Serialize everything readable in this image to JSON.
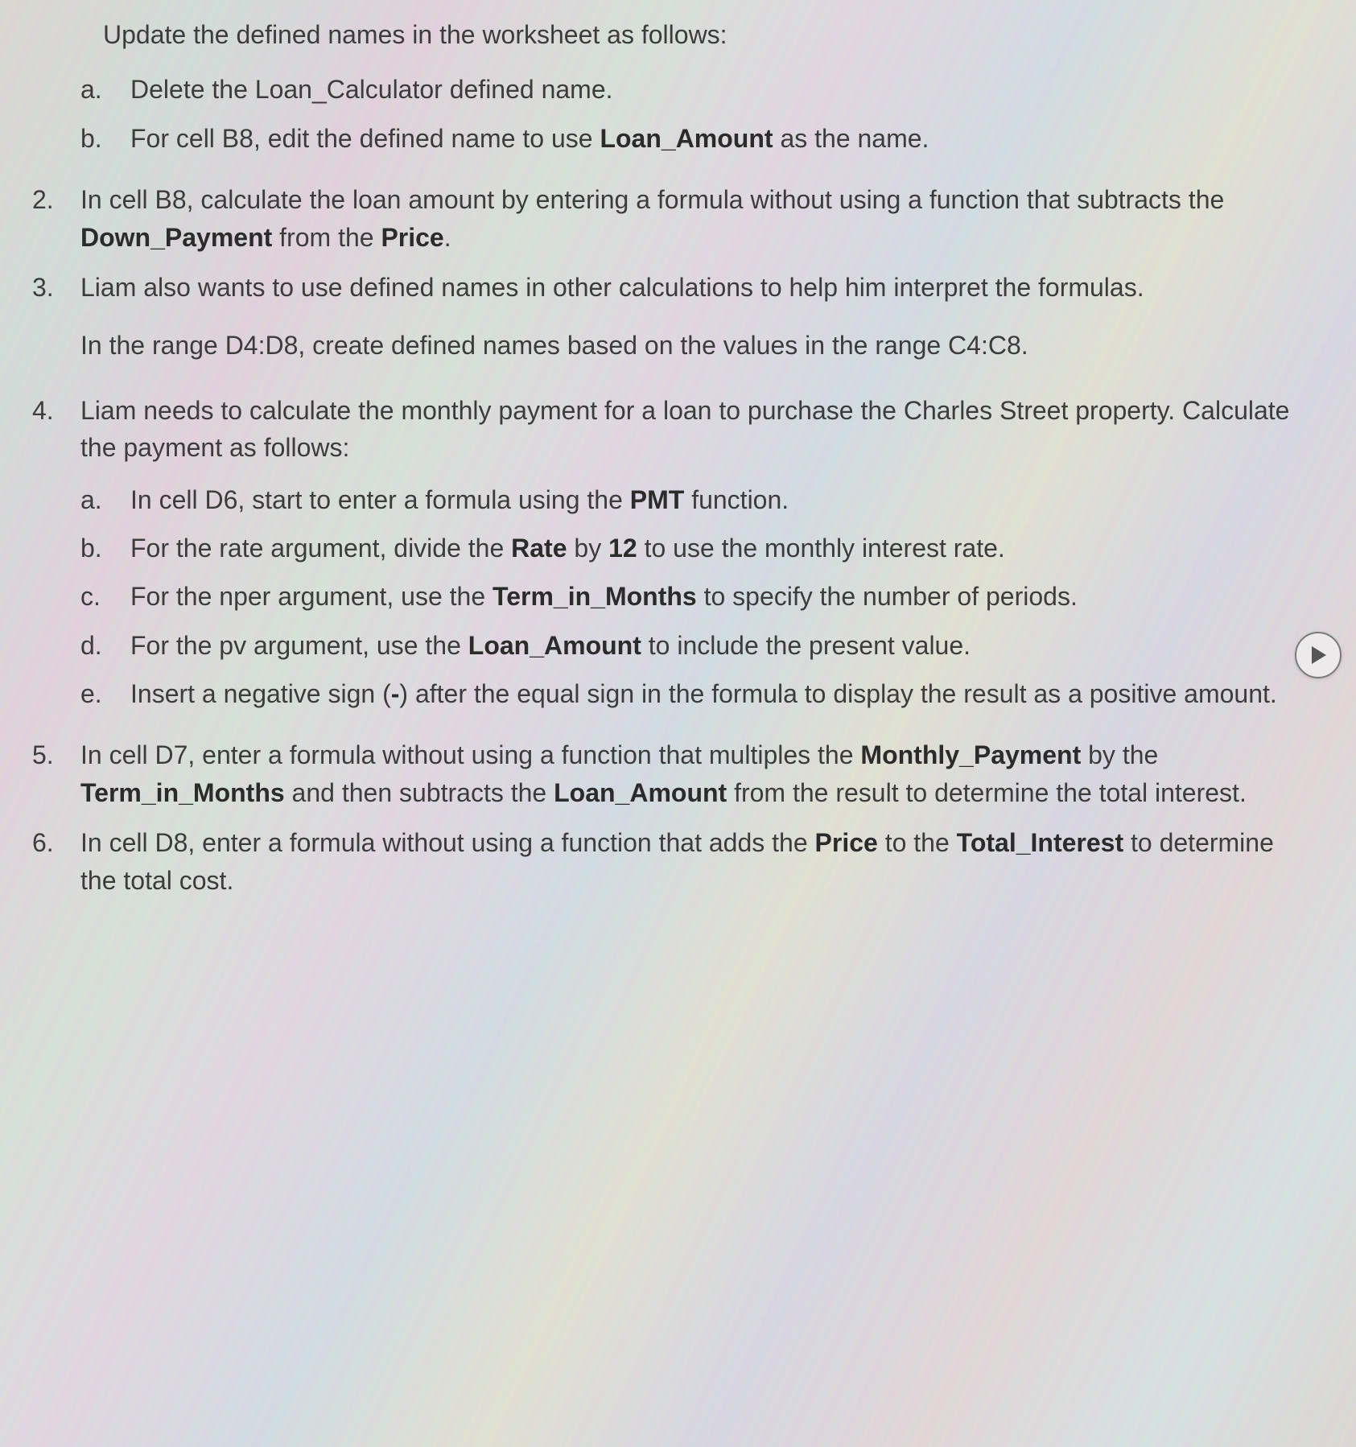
{
  "intro": "Update the defined names in the worksheet as follows:",
  "item1_sub": {
    "a": {
      "letter": "a.",
      "text": "Delete the Loan_Calculator defined name."
    },
    "b": {
      "letter": "b.",
      "html": "For cell B8, edit the defined name to use <b>Loan_Amount</b> as the name."
    }
  },
  "items": {
    "2": {
      "num": "2.",
      "html": "In cell B8, calculate the loan amount by entering a formula without using a function that subtracts the <b>Down_Payment</b> from the <b>Price</b>."
    },
    "3": {
      "num": "3.",
      "p1": "Liam also wants to use defined names in other calculations to help him interpret the formulas.",
      "p2": "In the range D4:D8, create defined names based on the values in the range C4:C8."
    },
    "4": {
      "num": "4.",
      "lead": "Liam needs to calculate the monthly payment for a loan to purchase the Charles Street property. Calculate the payment as follows:",
      "sub": {
        "a": {
          "letter": "a.",
          "html": "In cell D6, start to enter a formula using the <b>PMT</b> function."
        },
        "b": {
          "letter": "b.",
          "html": "For the rate argument, divide the <b>Rate</b> by <b>12</b> to use the monthly interest rate."
        },
        "c": {
          "letter": "c.",
          "html": "For the nper argument, use the <b>Term_in_Months</b> to specify the number of periods."
        },
        "d": {
          "letter": "d.",
          "html": "For the pv argument, use the <b>Loan_Amount</b> to include the present value."
        },
        "e": {
          "letter": "e.",
          "html": "Insert a negative sign (<b>-</b>) after the equal sign in the formula to display the result as a positive amount."
        }
      }
    },
    "5": {
      "num": "5.",
      "html": "In cell D7, enter a formula without using a function that multiples the <b>Monthly_Payment</b> by the <b>Term_in_Months</b> and then subtracts the <b>Loan_Amount</b> from the result to determine the total interest."
    },
    "6": {
      "num": "6.",
      "html": "In cell D8, enter a formula without using a function that adds the <b>Price</b> to the <b>Total_Interest</b> to determine the total cost."
    }
  },
  "icons": {
    "play": "play"
  }
}
